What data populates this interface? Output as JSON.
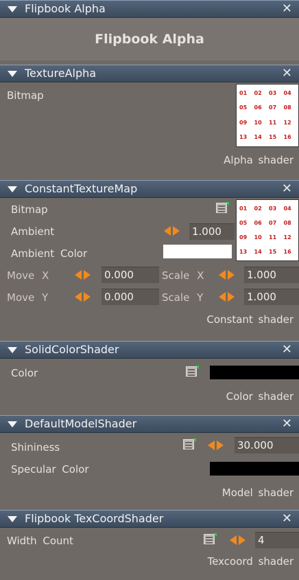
{
  "panels": {
    "flipbook_alpha": {
      "title": "Flipbook Alpha",
      "heading": "Flipbook Alpha",
      "close": "✕"
    },
    "texture_alpha": {
      "title": "TextureAlpha",
      "close": "✕",
      "bitmap_label": "Bitmap",
      "footer": "Alpha shader",
      "thumbnail_cells": [
        "01",
        "02",
        "03",
        "04",
        "05",
        "06",
        "07",
        "08",
        "09",
        "10",
        "11",
        "12",
        "13",
        "14",
        "15",
        "16"
      ]
    },
    "constant_texture_map": {
      "title": "ConstantTextureMap",
      "close": "✕",
      "bitmap_label": "Bitmap",
      "ambient_label": "Ambient",
      "ambient_value": "1.000",
      "ambient_color_label": "Ambient Color",
      "ambient_color": "#ffffff",
      "move_x_label": "Move X",
      "move_x_value": "0.000",
      "scale_x_label": "Scale X",
      "scale_x_value": "1.000",
      "move_y_label": "Move Y",
      "move_y_value": "0.000",
      "scale_y_label": "Scale Y",
      "scale_y_value": "1.000",
      "footer": "Constant shader",
      "thumbnail_cells": [
        "01",
        "02",
        "03",
        "04",
        "05",
        "06",
        "07",
        "08",
        "09",
        "10",
        "11",
        "12",
        "13",
        "14",
        "15",
        "16"
      ]
    },
    "solid_color_shader": {
      "title": "SolidColorShader",
      "close": "✕",
      "color_label": "Color",
      "color_value": "#000000",
      "footer": "Color shader"
    },
    "default_model_shader": {
      "title": "DefaultModelShader",
      "close": "✕",
      "shininess_label": "Shininess",
      "shininess_value": "30.000",
      "specular_color_label": "Specular Color",
      "specular_color": "#000000",
      "footer": "Model shader"
    },
    "flipbook_texcoord_shader": {
      "title": "Flipbook TexCoordShader",
      "close": "✕",
      "width_count_label": "Width Count",
      "width_count_value": "4",
      "footer": "Texcoord shader"
    }
  },
  "colors": {
    "header_top": "#55657a",
    "header_bottom": "#3b4a5c",
    "panel_bg": "#6f6965",
    "spinner_accent": "#f08a1e",
    "thumbnail_text": "#c21a1a"
  }
}
